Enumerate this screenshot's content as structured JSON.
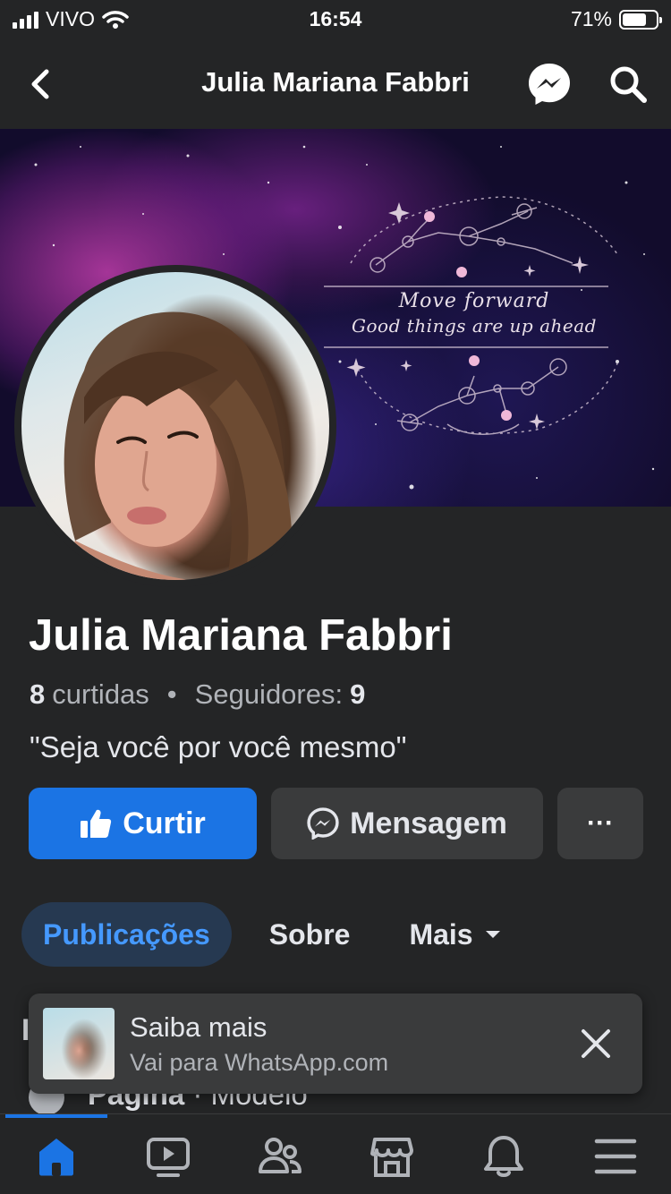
{
  "status_bar": {
    "carrier": "VIVO",
    "time": "16:54",
    "battery_percent": "71%",
    "battery_level": 0.71
  },
  "nav": {
    "title": "Julia Mariana Fabbri",
    "icons": [
      "back-arrow-icon",
      "messenger-icon",
      "search-icon"
    ]
  },
  "cover": {
    "line1": "Move forward",
    "line2": "Good things are up ahead"
  },
  "profile": {
    "name": "Julia Mariana Fabbri",
    "likes_count": "8",
    "likes_label": "curtidas",
    "separator": "•",
    "followers_label": "Seguidores:",
    "followers_count": "9",
    "bio": "\"Seja você por você mesmo\""
  },
  "actions": {
    "like_label": "Curtir",
    "message_label": "Mensagem",
    "more_label": "···",
    "like_color": "#1b74e4"
  },
  "tabs": {
    "items": [
      {
        "label": "Publicações",
        "active": true
      },
      {
        "label": "Sobre",
        "active": false
      },
      {
        "label": "Mais",
        "active": false
      }
    ]
  },
  "background_row": {
    "letter": "I",
    "bold": "Página",
    "separator": " · ",
    "rest": "Modelo"
  },
  "toast": {
    "title": "Saiba mais",
    "subtitle": "Vai para WhatsApp.com"
  },
  "bottom_nav": {
    "items": [
      "home-icon",
      "video-icon",
      "friends-icon",
      "marketplace-icon",
      "bell-icon",
      "menu-icon"
    ]
  }
}
